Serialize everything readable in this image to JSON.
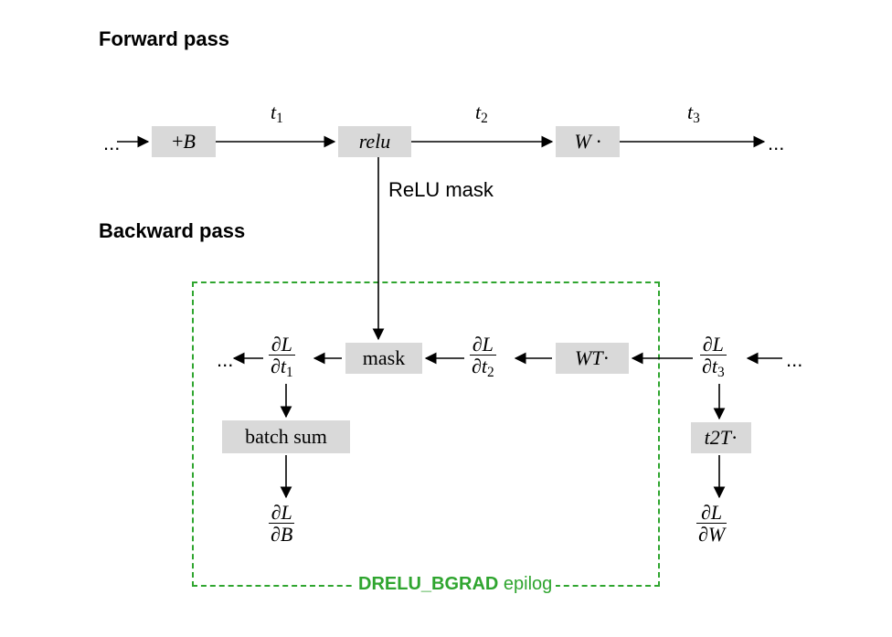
{
  "headings": {
    "forward": "Forward pass",
    "backward": "Backward pass"
  },
  "forward": {
    "ellipsis_left": "...",
    "box_bias": "+B",
    "label_t1": "t",
    "label_t1_sub": "1",
    "box_relu": "relu",
    "label_t2": "t",
    "label_t2_sub": "2",
    "box_W": "W ·",
    "label_t3": "t",
    "label_t3_sub": "3",
    "ellipsis_right": "...",
    "relu_mask_label": "ReLU mask"
  },
  "backward": {
    "ellipsis_left": "...",
    "dL_dt1_num": "∂L",
    "dL_dt1_den_var": "∂t",
    "dL_dt1_den_sub": "1",
    "box_mask": "mask",
    "dL_dt2_num": "∂L",
    "dL_dt2_den_var": "∂t",
    "dL_dt2_den_sub": "2",
    "box_WT_base": "W",
    "box_WT_sup": "T",
    "box_WT_dot": " ·",
    "dL_dt3_num": "∂L",
    "dL_dt3_den_var": "∂t",
    "dL_dt3_den_sub": "3",
    "ellipsis_right": "...",
    "box_batchsum": "batch sum",
    "dL_dB_num": "∂L",
    "dL_dB_den": "∂B",
    "box_t2T_base": "t",
    "box_t2T_sub": "2",
    "box_t2T_sup": "T",
    "box_t2T_dot": " ·",
    "dL_dW_num": "∂L",
    "dL_dW_den": "∂W"
  },
  "epilog": {
    "label_strong": "DRELU_BGRAD",
    "label_tail": " epilog"
  }
}
